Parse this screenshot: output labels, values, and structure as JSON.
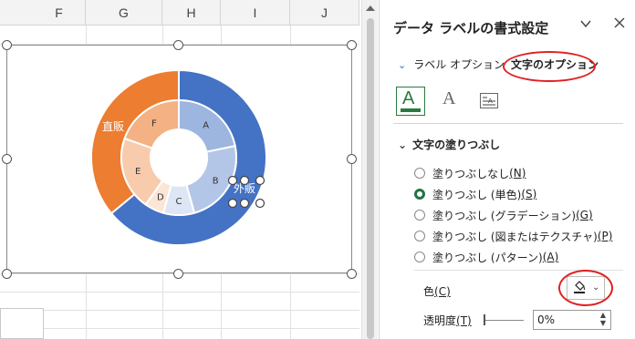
{
  "sheet": {
    "columns": [
      "F",
      "G",
      "H",
      "I",
      "J"
    ]
  },
  "chart": {
    "inner_ring": [
      {
        "label": "A",
        "value": 20,
        "color": "#9db6df"
      },
      {
        "label": "B",
        "value": 22,
        "color": "#b4c6e7"
      },
      {
        "label": "C",
        "value": 8,
        "color": "#dde6f4"
      },
      {
        "label": "D",
        "value": 5,
        "color": "#fbe5d6"
      },
      {
        "label": "E",
        "value": 19,
        "color": "#f8cbad"
      },
      {
        "label": "F",
        "value": 18,
        "color": "#f4b183"
      }
    ],
    "outer_ring": [
      {
        "label": "外販",
        "value": 64,
        "color": "#4472c4"
      },
      {
        "label": "直販",
        "value": 36,
        "color": "#ed7d31"
      }
    ]
  },
  "pane": {
    "title": "データ ラベルの書式設定",
    "tabs": {
      "label_options": "ラベル オプション",
      "text_options": "文字のオプション"
    },
    "icon_tabs": [
      "text-fill-outline",
      "text-effects",
      "textbox"
    ],
    "section_header": "文字の塗りつぶし",
    "radio_options": [
      {
        "label": "塗りつぶしなし",
        "key": "(N)",
        "selected": false
      },
      {
        "label": "塗りつぶし (単色)",
        "key": "(S)",
        "selected": true
      },
      {
        "label": "塗りつぶし (グラデーション)",
        "key": "(G)",
        "selected": false
      },
      {
        "label": "塗りつぶし (図またはテクスチャ)",
        "key": "(P)",
        "selected": false
      },
      {
        "label": "塗りつぶし (パターン)",
        "key": "(A)",
        "selected": false
      }
    ],
    "color": {
      "label": "色",
      "key": "(C)"
    },
    "transparency": {
      "label": "透明度",
      "key": "(T)",
      "value": "0%"
    }
  },
  "colors": {
    "accent_green": "#217346",
    "annotation_red": "#e02020"
  }
}
